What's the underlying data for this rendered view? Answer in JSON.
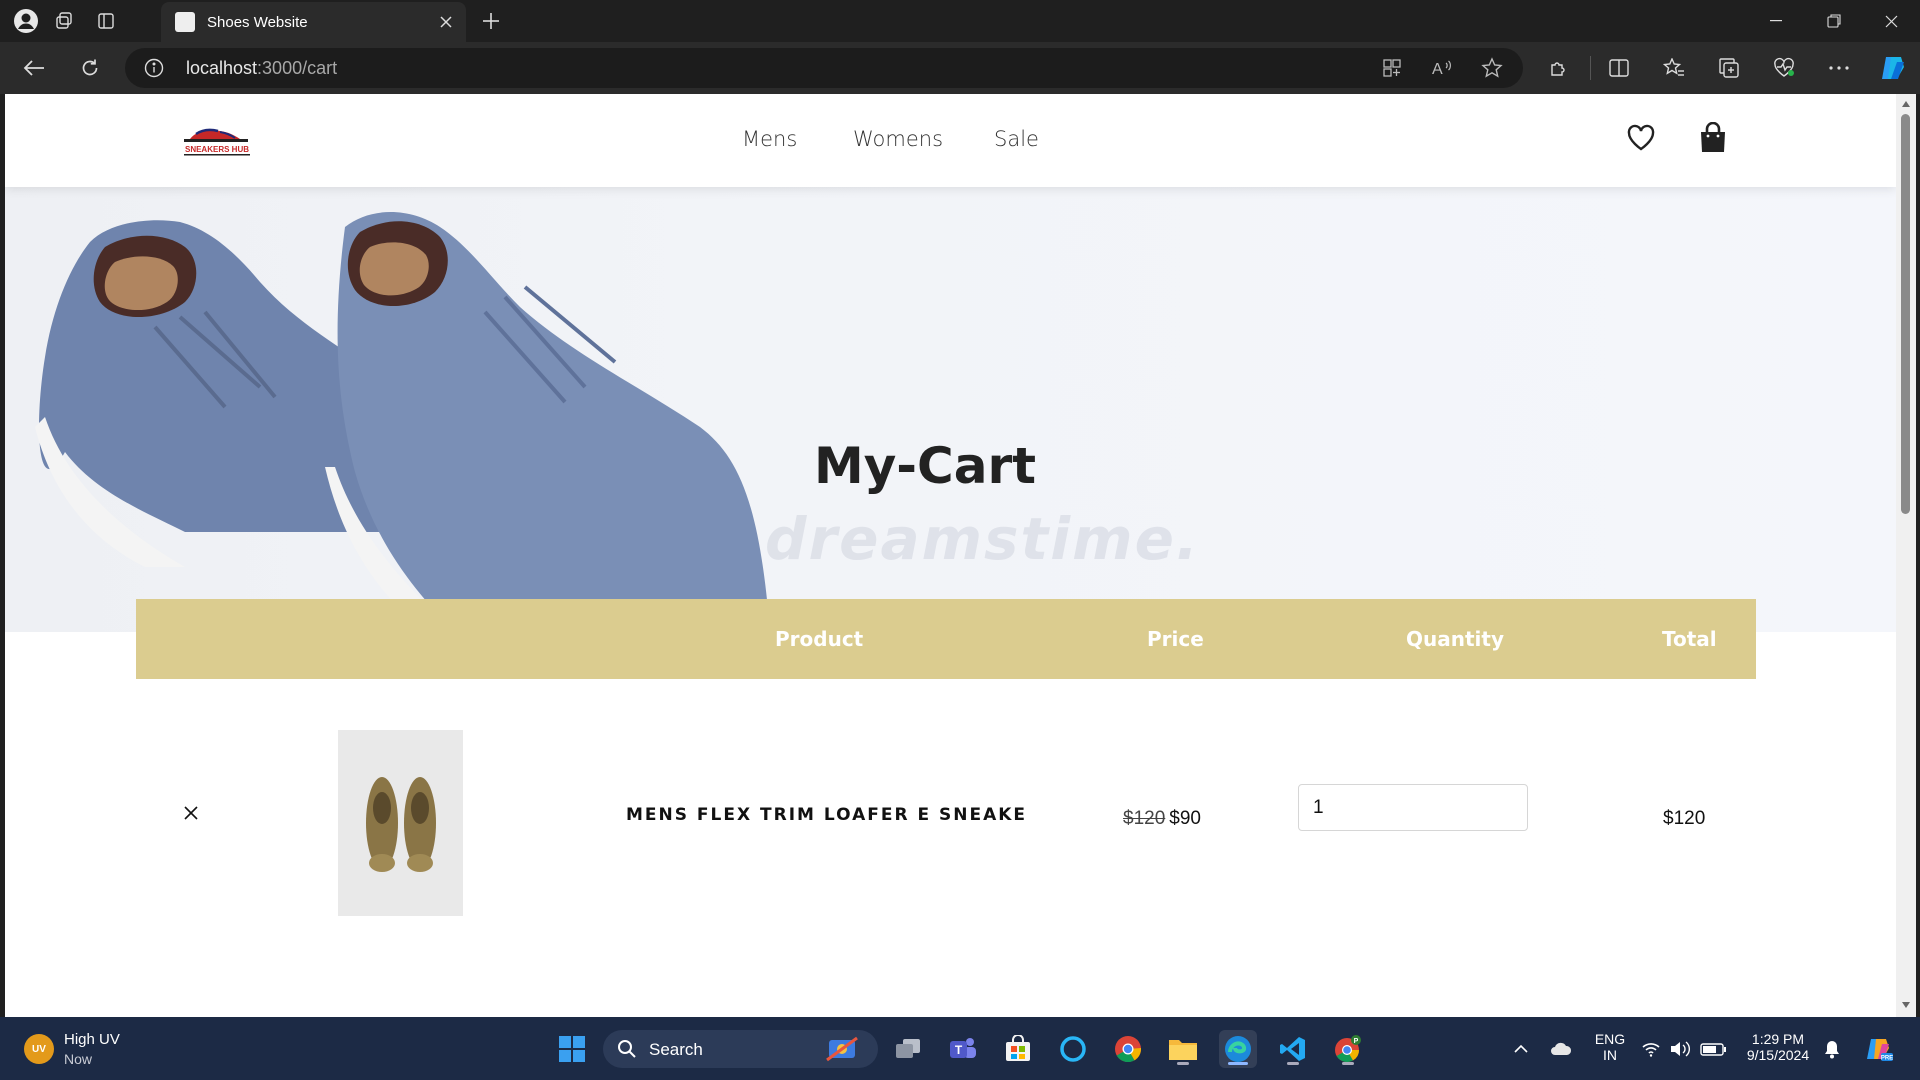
{
  "browser": {
    "tab_title": "Shoes Website",
    "address_host": "localhost",
    "address_path": ":3000/cart"
  },
  "site": {
    "logo_text": "SNEAKERS HUB",
    "nav": [
      "Mens",
      "Womens",
      "Sale"
    ]
  },
  "hero": {
    "title": "My-Cart",
    "watermark": "dreamstime."
  },
  "cart": {
    "headers": {
      "product": "Product",
      "price": "Price",
      "quantity": "Quantity",
      "total": "Total"
    },
    "items": [
      {
        "remove_glyph": "×",
        "name": "MENS FLEX TRIM LOAFER E SNEAKE",
        "old_price": "$120",
        "price": "$90",
        "quantity": "1",
        "total": "$120"
      }
    ]
  },
  "taskbar": {
    "weather_badge": "UV",
    "weather_title": "High UV",
    "weather_sub": "Now",
    "search_label": "Search",
    "lang_line1": "ENG",
    "lang_line2": "IN",
    "time": "1:29 PM",
    "date": "9/15/2024"
  },
  "colors": {
    "cart_header_bg": "#dbcc8f",
    "taskbar_bg": "#1c2a45",
    "browser_bg": "#2b2b2b"
  }
}
